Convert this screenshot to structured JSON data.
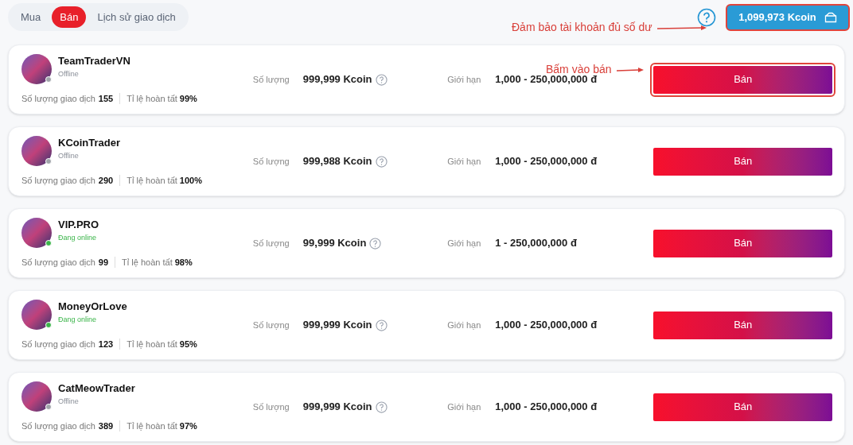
{
  "tabs": [
    {
      "label": "Mua",
      "selected": false
    },
    {
      "label": "Bán",
      "selected": true
    },
    {
      "label": "Lịch sử giao dịch",
      "selected": false
    }
  ],
  "balance": {
    "amount": "1,099,973 Kcoin",
    "highlighted": true
  },
  "annotations": [
    {
      "text": "Đảm bảo tài khoản đủ số dư"
    },
    {
      "text": "Bấm vào bán"
    }
  ],
  "offers": [
    {
      "name": "TeamTraderVN",
      "online": false,
      "status": "Offline",
      "trades_label": "Số lượng giao dịch",
      "trades": "155",
      "rate_label": "Tỉ lệ hoàn tất",
      "rate": "99%",
      "qty_label": "Số lượng",
      "qty": "999,999 Kcoin",
      "limit_label": "Giới hạn",
      "limit": "1,000 - 250,000,000 đ",
      "button": "Bán",
      "highlighted": true
    },
    {
      "name": "KCoinTrader",
      "online": false,
      "status": "Offline",
      "trades_label": "Số lượng giao dịch",
      "trades": "290",
      "rate_label": "Tỉ lệ hoàn tất",
      "rate": "100%",
      "qty_label": "Số lượng",
      "qty": "999,988 Kcoin",
      "limit_label": "Giới hạn",
      "limit": "1,000 - 250,000,000 đ",
      "button": "Bán",
      "highlighted": false
    },
    {
      "name": "VIP.PRO",
      "online": true,
      "status": "Đang online",
      "trades_label": "Số lượng giao dịch",
      "trades": "99",
      "rate_label": "Tỉ lệ hoàn tất",
      "rate": "98%",
      "qty_label": "Số lượng",
      "qty": "99,999 Kcoin",
      "limit_label": "Giới hạn",
      "limit": "1 - 250,000,000 đ",
      "button": "Bán",
      "highlighted": false
    },
    {
      "name": "MoneyOrLove",
      "online": true,
      "status": "Đang online",
      "trades_label": "Số lượng giao dịch",
      "trades": "123",
      "rate_label": "Tỉ lệ hoàn tất",
      "rate": "95%",
      "qty_label": "Số lượng",
      "qty": "999,999 Kcoin",
      "limit_label": "Giới hạn",
      "limit": "1,000 - 250,000,000 đ",
      "button": "Bán",
      "highlighted": false
    },
    {
      "name": "CatMeowTrader",
      "online": false,
      "status": "Offline",
      "trades_label": "Số lượng giao dịch",
      "trades": "389",
      "rate_label": "Tỉ lệ hoàn tất",
      "rate": "97%",
      "qty_label": "Số lượng",
      "qty": "999,999 Kcoin",
      "limit_label": "Giới hạn",
      "limit": "1,000 - 250,000,000 đ",
      "button": "Bán",
      "highlighted": false
    }
  ]
}
